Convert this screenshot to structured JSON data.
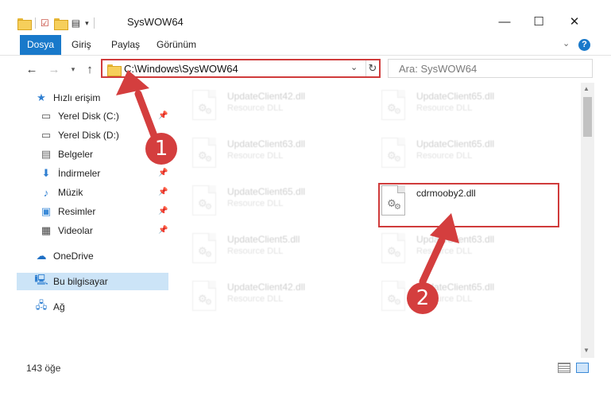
{
  "window": {
    "title": "SysWOW64",
    "controls": {
      "minimize": "—",
      "maximize": "☐",
      "close": "✕"
    }
  },
  "ribbon": {
    "tabs": [
      {
        "label": "Dosya",
        "active": true
      },
      {
        "label": "Giriş",
        "active": false
      },
      {
        "label": "Paylaş",
        "active": false
      },
      {
        "label": "Görünüm",
        "active": false
      }
    ],
    "help": "?"
  },
  "address": {
    "path": "C:\\Windows\\SysWOW64",
    "search_placeholder": "Ara: SysWOW64"
  },
  "sidebar": {
    "items": [
      {
        "label": "Hızlı erişim",
        "icon": "star-icon",
        "pinned": false
      },
      {
        "label": "Yerel Disk (C:)",
        "icon": "drive-icon",
        "pinned": true
      },
      {
        "label": "Yerel Disk (D:)",
        "icon": "drive-icon",
        "pinned": false
      },
      {
        "label": "Belgeler",
        "icon": "documents-icon",
        "pinned": false
      },
      {
        "label": "İndirmeler",
        "icon": "download-icon",
        "pinned": true
      },
      {
        "label": "Müzik",
        "icon": "music-icon",
        "pinned": true
      },
      {
        "label": "Resimler",
        "icon": "pictures-icon",
        "pinned": true
      },
      {
        "label": "Videolar",
        "icon": "videos-icon",
        "pinned": true
      },
      {
        "label": "OneDrive",
        "icon": "cloud-icon",
        "pinned": false
      },
      {
        "label": "Bu bilgisayar",
        "icon": "computer-icon",
        "pinned": false,
        "selected": true
      },
      {
        "label": "Ağ",
        "icon": "network-icon",
        "pinned": false
      }
    ]
  },
  "files": [
    {
      "name": "UpdateClient42.dll",
      "type": "Resource DLL"
    },
    {
      "name": "UpdateClient65.dll",
      "type": "Resource DLL"
    },
    {
      "name": "UpdateClient63.dll",
      "type": "Resource DLL"
    },
    {
      "name": "UpdateClient65.dll",
      "type": "Resource DLL"
    },
    {
      "name": "UpdateClient65.dll",
      "type": "Resource DLL"
    },
    {
      "name": "cdrmooby2.dll",
      "type": ""
    },
    {
      "name": "UpdateClient5.dll",
      "type": "Resource DLL"
    },
    {
      "name": "UpdateClient63.dll",
      "type": "Resource DLL"
    },
    {
      "name": "UpdateClient42.dll",
      "type": "Resource DLL"
    },
    {
      "name": "UpdateClient65.dll",
      "type": "Resource DLL"
    }
  ],
  "status": {
    "item_count": "143 öğe"
  },
  "annotations": {
    "step1": "1",
    "step2": "2"
  },
  "colors": {
    "accent": "#1979ca",
    "highlight": "#d03b3b",
    "selected": "#cce4f7"
  }
}
